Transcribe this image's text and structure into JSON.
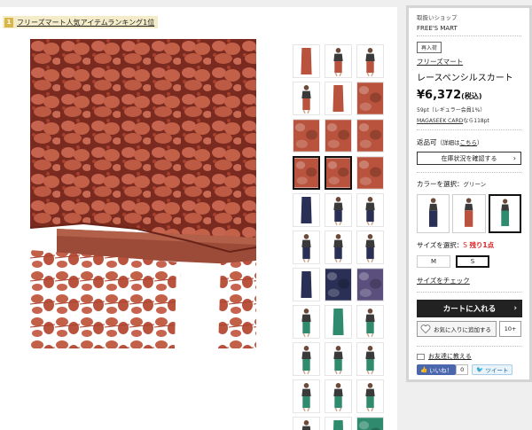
{
  "ranking_badge": {
    "number": "1",
    "text": "フリーズマート人気アイテムランキング1位"
  },
  "main_image": {
    "alt_icon": "lace-skirt-closeup-photo",
    "color": "#b9533d"
  },
  "thumbnails": [
    {
      "kind": "product",
      "color": "#b9533d"
    },
    {
      "kind": "model",
      "color": "#b9533d"
    },
    {
      "kind": "model",
      "color": "#b9533d"
    },
    {
      "kind": "model",
      "color": "#b9533d"
    },
    {
      "kind": "product",
      "color": "#b9533d"
    },
    {
      "kind": "lace",
      "color": "#b9533d"
    },
    {
      "kind": "lace",
      "color": "#b9533d"
    },
    {
      "kind": "lace",
      "color": "#b9533d"
    },
    {
      "kind": "lace",
      "color": "#b9533d"
    },
    {
      "kind": "lace",
      "color": "#b9533d",
      "selected": true
    },
    {
      "kind": "lace",
      "color": "#b9533d",
      "selected": true
    },
    {
      "kind": "lace",
      "color": "#b9533d"
    },
    {
      "kind": "product",
      "color": "#2a2f55"
    },
    {
      "kind": "model",
      "color": "#2a2f55"
    },
    {
      "kind": "model",
      "color": "#2a2f55"
    },
    {
      "kind": "model",
      "color": "#2a2f55"
    },
    {
      "kind": "model",
      "color": "#2a2f55"
    },
    {
      "kind": "model",
      "color": "#2a2f55"
    },
    {
      "kind": "product",
      "color": "#2a2f55"
    },
    {
      "kind": "lace",
      "color": "#2a2f55"
    },
    {
      "kind": "lace",
      "color": "#5a4f7d"
    },
    {
      "kind": "model",
      "color": "#2f8a6e"
    },
    {
      "kind": "product",
      "color": "#2f8a6e"
    },
    {
      "kind": "model",
      "color": "#2f8a6e"
    },
    {
      "kind": "model",
      "color": "#2f8a6e"
    },
    {
      "kind": "model",
      "color": "#2f8a6e"
    },
    {
      "kind": "model",
      "color": "#2f8a6e"
    },
    {
      "kind": "model",
      "color": "#2f8a6e"
    },
    {
      "kind": "model",
      "color": "#2f8a6e"
    },
    {
      "kind": "model",
      "color": "#2f8a6e"
    },
    {
      "kind": "model",
      "color": "#2f8a6e"
    },
    {
      "kind": "product",
      "color": "#2f8a6e"
    },
    {
      "kind": "lace",
      "color": "#2f8a6e"
    }
  ],
  "side": {
    "shop_label": "取扱いショップ",
    "shop_name": "FREE'S MART",
    "tag": "再入荷",
    "brand": "フリーズマート",
    "product_name": "レースペンシルスカート",
    "price": "¥6,372",
    "price_tax": "(税込)",
    "points": "59pt（レギュラー会員1%）",
    "seek_link": "MAGASEEK CARD",
    "seek_text": "なら118pt",
    "returns_label": "返品可",
    "returns_paren_open": "（詳細は",
    "returns_link": "こちら",
    "returns_paren_close": "）",
    "stock_button": "在庫状況を確認する",
    "color_label": "カラーを選択：",
    "color_selected": "グリーン",
    "colors": [
      {
        "name": "navy",
        "color": "#2a2f55"
      },
      {
        "name": "red",
        "color": "#b9533d"
      },
      {
        "name": "green",
        "color": "#2f8a6e",
        "selected": true
      }
    ],
    "size_label": "サイズを選択：",
    "size_selected": "S",
    "size_stock": "残り1点",
    "sizes": [
      {
        "label": "M"
      },
      {
        "label": "S",
        "selected": true
      }
    ],
    "size_check": "サイズをチェック",
    "cart_button": "カートに入れる",
    "fav_button": "お気に入りに追加する",
    "fav_count": "10+",
    "friend_link": "お友達に教える",
    "fb_label": "いいね！",
    "fb_count": "0",
    "tw_label": "ツイート"
  }
}
